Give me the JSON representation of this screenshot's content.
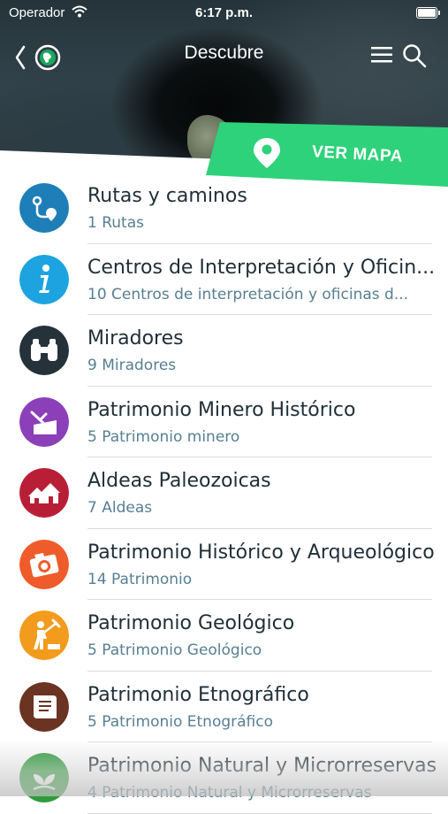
{
  "status_bar": {
    "carrier": "Operador",
    "time": "6:17 p.m."
  },
  "nav": {
    "title": "Descubre"
  },
  "map_button": {
    "label": "VER MAPA",
    "color": "#2ed27a"
  },
  "categories": [
    {
      "title": "Rutas y caminos",
      "subtitle": "1 Rutas",
      "icon": "route-icon",
      "color": "#1e7fb8"
    },
    {
      "title": "Centros de Interpretación y Oficin...",
      "subtitle": "10 Centros de interpretación y oficinas d...",
      "icon": "info-icon",
      "color": "#1da4e0"
    },
    {
      "title": "Miradores",
      "subtitle": "9 Miradores",
      "icon": "binoculars-icon",
      "color": "#26323a"
    },
    {
      "title": "Patrimonio Minero Histórico",
      "subtitle": "5 Patrimonio minero",
      "icon": "mine-cart-icon",
      "color": "#8b3fb8"
    },
    {
      "title": "Aldeas Paleozoicas",
      "subtitle": "7 Aldeas",
      "icon": "village-icon",
      "color": "#b81f37"
    },
    {
      "title": "Patrimonio Histórico y Arqueológico",
      "subtitle": "14 Patrimonio",
      "icon": "camera-icon",
      "color": "#ef5b2a"
    },
    {
      "title": "Patrimonio Geológico",
      "subtitle": "5 Patrimonio Geológico",
      "icon": "geologist-icon",
      "color": "#f29b1c"
    },
    {
      "title": "Patrimonio Etnográfico",
      "subtitle": "5 Patrimonio Etnográfico",
      "icon": "scroll-icon",
      "color": "#6b3321"
    },
    {
      "title": "Patrimonio Natural y Microrreservas",
      "subtitle": "4 Patrimonio Natural y Microrreservas",
      "icon": "plant-icon",
      "color": "#2f9c3c"
    }
  ]
}
